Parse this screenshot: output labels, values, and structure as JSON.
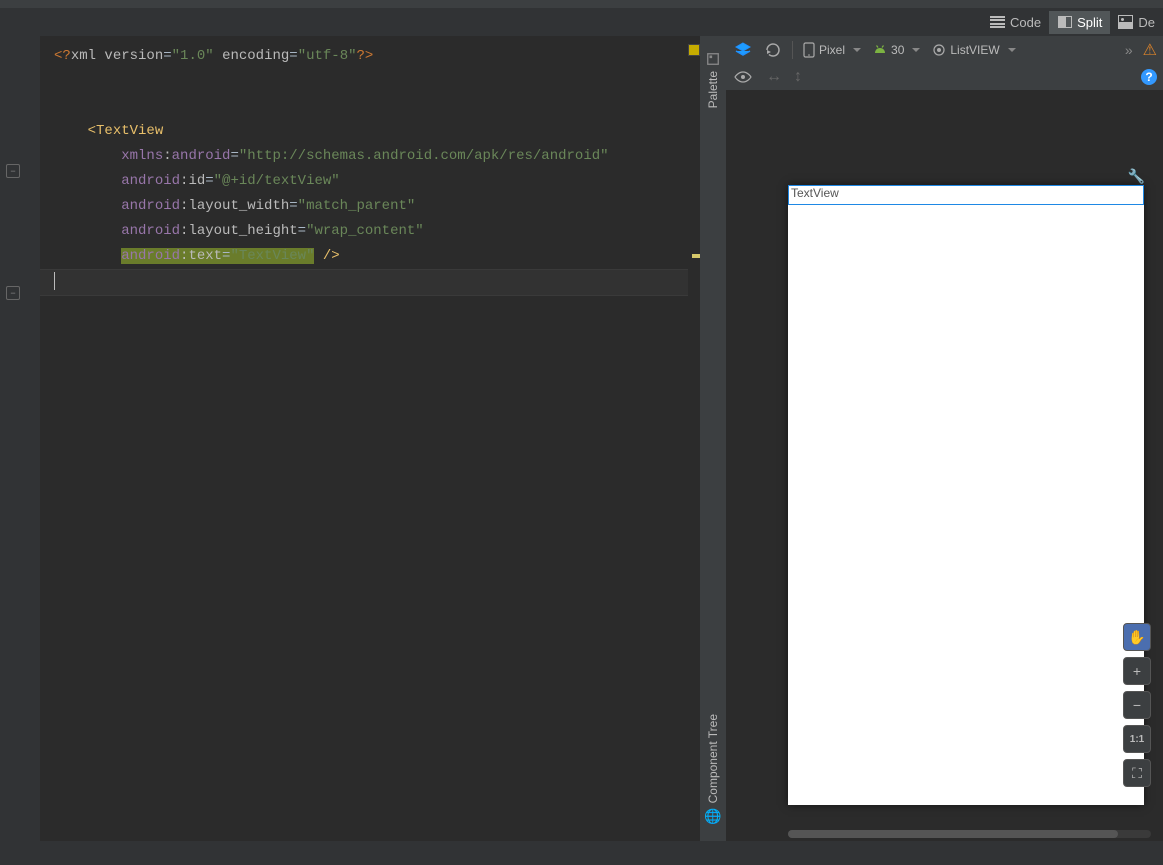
{
  "viewModes": {
    "code": "Code",
    "split": "Split",
    "design": "De"
  },
  "activeView": "split",
  "code": {
    "xmlDecl": {
      "pi1": "<?",
      "xml": "xml ",
      "verAttr": "version",
      "verVal": "\"1.0\"",
      "encAttr": "encoding",
      "encVal": "\"utf-8\"",
      "pi2": "?>"
    },
    "tagOpen": "<TextView",
    "xmlnsPrefix": "xmlns",
    "androidNs": "android",
    "xmlnsVal": "\"http://schemas.android.com/apk/res/android\"",
    "idAttr": "id",
    "idVal": "\"@+id/textView\"",
    "lwAttr": "layout_width",
    "lwVal": "\"match_parent\"",
    "lhAttr": "layout_height",
    "lhVal": "\"wrap_content\"",
    "textAttr": "text",
    "textVal": "\"TextView\"",
    "tagClose": " />"
  },
  "sideTabs": {
    "palette": "Palette",
    "componentTree": "Component Tree"
  },
  "designToolbar": {
    "device": "Pixel",
    "api": "30",
    "theme": "ListVIEW"
  },
  "preview": {
    "textViewLabel": "TextView"
  },
  "zoom": {
    "hand": "✋",
    "plus": "+",
    "minus": "−",
    "oneToOne": "1:1",
    "fit": "⛶"
  }
}
